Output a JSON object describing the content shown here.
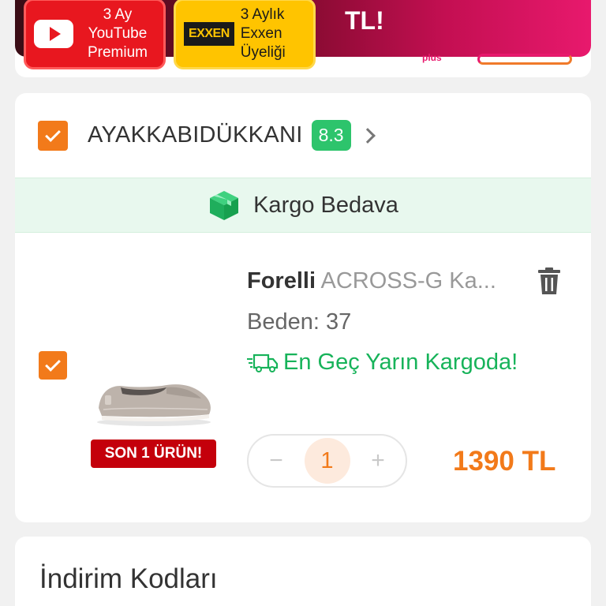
{
  "promo": {
    "youtube_tile": "3 Ay YouTube Premium",
    "exxen_logo": "EXXEN",
    "exxen_tile": "3 Aylık Exxen Üyeliği",
    "currency_text": "TL!",
    "plus_label": "plus"
  },
  "seller": {
    "name": "AYAKKABIDÜKKANI",
    "score": "8.3"
  },
  "shipping": {
    "free_cargo": "Kargo Bedava"
  },
  "product": {
    "brand": "Forelli",
    "name": "ACROSS-G Ka...",
    "size": "Beden: 37",
    "delivery": "En Geç Yarın Kargoda!",
    "stock_badge": "SON 1 ÜRÜN!",
    "quantity": "1",
    "minus": "−",
    "plus": "+",
    "price": "1390 TL"
  },
  "discount": {
    "title": "İndirim Kodları"
  },
  "colors": {
    "accent": "#f27a1a",
    "success": "#2dc46c",
    "danger": "#c4000b"
  }
}
